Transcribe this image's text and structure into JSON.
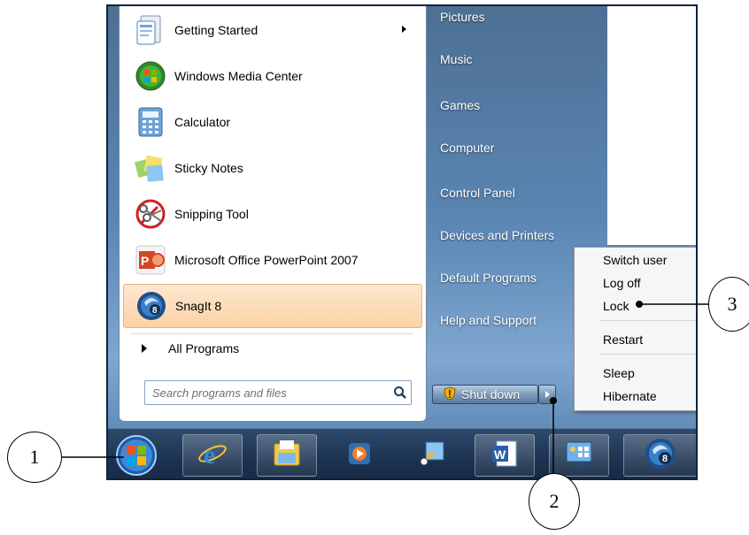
{
  "programs": [
    {
      "label": "Getting Started",
      "icon": "getting-started-icon",
      "has_submenu": true
    },
    {
      "label": "Windows Media Center",
      "icon": "windows-media-center-icon"
    },
    {
      "label": "Calculator",
      "icon": "calculator-icon"
    },
    {
      "label": "Sticky Notes",
      "icon": "sticky-notes-icon"
    },
    {
      "label": "Snipping Tool",
      "icon": "snipping-tool-icon"
    },
    {
      "label": "Microsoft Office PowerPoint 2007",
      "icon": "powerpoint-icon"
    },
    {
      "label": "SnagIt 8",
      "icon": "snagit-icon",
      "highlighted": true
    }
  ],
  "all_programs": "All Programs",
  "search": {
    "placeholder": "Search programs and files"
  },
  "right_links": [
    "Pictures",
    "Music",
    "Games",
    "Computer",
    "Control Panel",
    "Devices and Printers",
    "Default Programs",
    "Help and Support"
  ],
  "shutdown": {
    "label": "Shut down"
  },
  "power_menu": {
    "items": [
      "Switch user",
      "Log off",
      "Lock",
      "Restart",
      "Sleep",
      "Hibernate"
    ]
  },
  "taskbar": {
    "items": [
      "start-orb-icon",
      "internet-explorer-icon",
      "windows-explorer-icon",
      "media-player-icon",
      "snipping-app-icon",
      "word-icon",
      "control-panel-icon",
      "snagit-taskbar-icon"
    ]
  },
  "callouts": [
    "1",
    "2",
    "3"
  ],
  "colors": {
    "highlight": "#fbd2a6",
    "taskbar": "#1c3250",
    "menu_bg": "#5a86b3"
  }
}
